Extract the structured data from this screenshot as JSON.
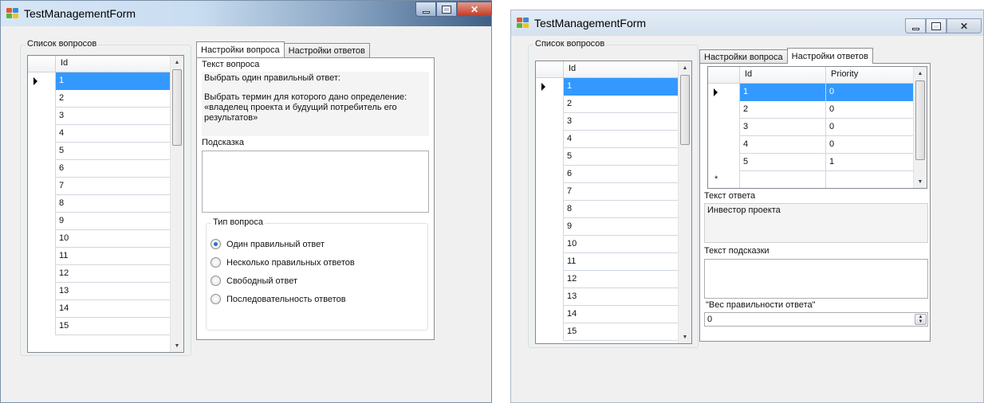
{
  "window_left": {
    "title": "TestManagementForm",
    "question_list": {
      "label": "Список вопросов",
      "column": "Id",
      "rows": [
        "1",
        "2",
        "3",
        "4",
        "5",
        "6",
        "7",
        "8",
        "9",
        "10",
        "11",
        "12",
        "13",
        "14",
        "15"
      ],
      "selected": "1"
    },
    "tabs": [
      "Настройки вопроса",
      "Настройки ответов"
    ],
    "active_tab": "Настройки вопроса",
    "question_text_label": "Текст вопроса",
    "question_text_line1": "Выбрать один правильный ответ:",
    "question_text_line2": "Выбрать термин для которого дано определение: «владелец проекта и будущий потребитель его результатов»",
    "hint_label": "Подсказка",
    "hint_value": "",
    "question_type": {
      "label": "Тип вопроса",
      "options": [
        "Один правильный ответ",
        "Несколько правильных ответов",
        "Свободный ответ",
        "Последовательность ответов"
      ],
      "selected": "Один правильный ответ"
    }
  },
  "window_right": {
    "title": "TestManagementForm",
    "question_list": {
      "label": "Список вопросов",
      "column": "Id",
      "rows": [
        "1",
        "2",
        "3",
        "4",
        "5",
        "6",
        "7",
        "8",
        "9",
        "10",
        "11",
        "12",
        "13",
        "14",
        "15"
      ],
      "selected": "1"
    },
    "tabs": [
      "Настройки вопроса",
      "Настройки ответов"
    ],
    "active_tab": "Настройки ответов",
    "answers_grid": {
      "columns": [
        "Id",
        "Priority"
      ],
      "rows": [
        [
          "1",
          "0"
        ],
        [
          "2",
          "0"
        ],
        [
          "3",
          "0"
        ],
        [
          "4",
          "0"
        ],
        [
          "5",
          "1"
        ]
      ],
      "new_row_marker": "*"
    },
    "answer_text_label": "Текст ответа",
    "answer_text_value": "Инвестор проекта",
    "hint_text_label": "Текст подсказки",
    "hint_text_value": "",
    "weight_label": "\"Вес правильности ответа\"",
    "weight_value": "0"
  },
  "colors": {
    "selection": "#3399ff",
    "window_bg": "#f0f0f0"
  }
}
